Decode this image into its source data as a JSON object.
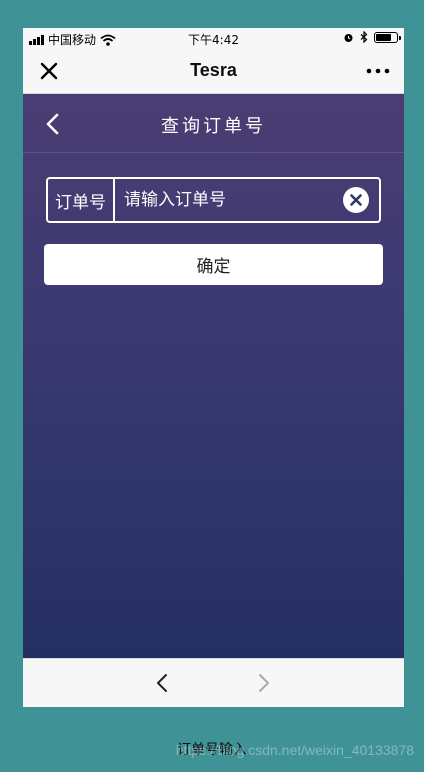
{
  "status_bar": {
    "carrier": "中国移动",
    "time": "下午4:42",
    "icons": [
      "signal-icon",
      "wifi-icon",
      "alarm-icon",
      "bluetooth-icon",
      "battery-icon"
    ],
    "battery_level": 0.7
  },
  "navbar": {
    "title": "Tesra",
    "close_icon": "close-icon",
    "more_icon": "more-icon"
  },
  "page": {
    "title": "查询订单号",
    "back_icon": "chevron-left-icon"
  },
  "form": {
    "label": "订单号",
    "input_value": "",
    "placeholder": "请输入订单号",
    "clear_icon": "clear-icon",
    "confirm_label": "确定"
  },
  "bottom_bar": {
    "back_icon": "chevron-left-icon",
    "forward_icon": "chevron-right-icon"
  },
  "caption": "订单号输入",
  "watermark": "https://blog.csdn.net/weixin_40133878",
  "colors": {
    "background": "#3f9396",
    "gradient_top": "#4b3d73",
    "gradient_bottom": "#252f62",
    "bar": "#f7f7f7"
  }
}
